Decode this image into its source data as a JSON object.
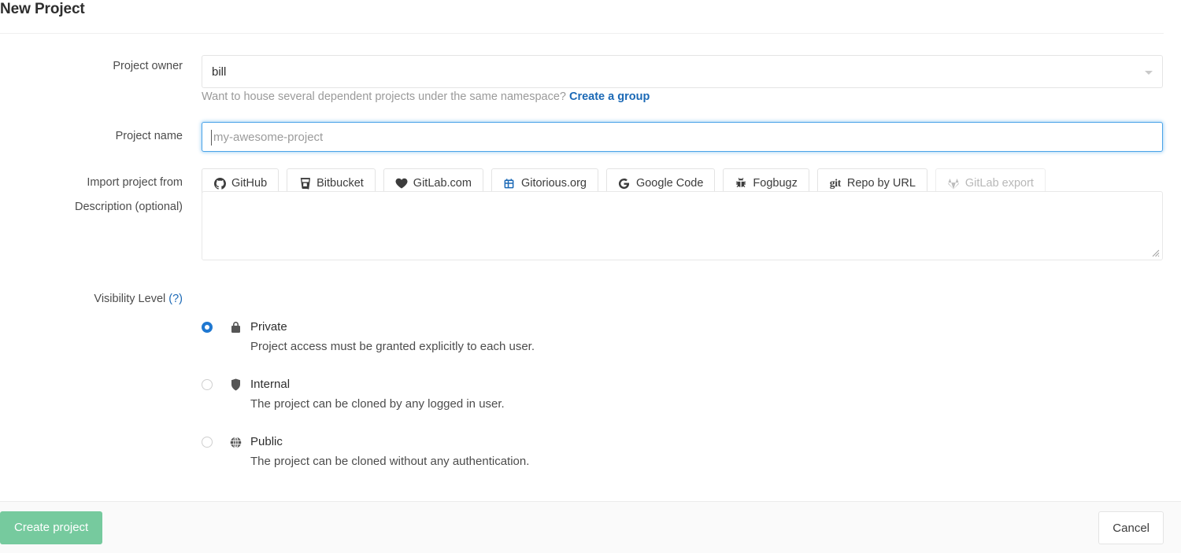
{
  "header": {
    "title": "New Project"
  },
  "form": {
    "owner": {
      "label": "Project owner",
      "value": "bill",
      "caret_icon": "chevron-down-icon",
      "helper_prefix": "Want to house several dependent projects under the same namespace?",
      "helper_link": "Create a group"
    },
    "name": {
      "label": "Project name",
      "value": "",
      "placeholder": "my-awesome-project"
    },
    "import": {
      "label": "Import project from",
      "buttons": [
        {
          "label": "GitHub",
          "icon": "github-icon",
          "disabled": false
        },
        {
          "label": "Bitbucket",
          "icon": "bitbucket-icon",
          "disabled": false
        },
        {
          "label": "GitLab.com",
          "icon": "heart-icon",
          "disabled": false
        },
        {
          "label": "Gitorious.org",
          "icon": "gitorious-icon",
          "disabled": false
        },
        {
          "label": "Google Code",
          "icon": "google-icon",
          "disabled": false
        },
        {
          "label": "Fogbugz",
          "icon": "bug-icon",
          "disabled": false
        },
        {
          "label": "Repo by URL",
          "icon": "git-text-icon",
          "disabled": false
        },
        {
          "label": "GitLab export",
          "icon": "gitlab-fox-icon",
          "disabled": true
        }
      ]
    },
    "description": {
      "label": "Description (optional)",
      "value": "",
      "resize_handle_icon": "resize-grip-icon"
    },
    "visibility": {
      "label": "Visibility Level",
      "help_label": "(?)",
      "options": [
        {
          "title": "Private",
          "icon": "lock-icon",
          "description": "Project access must be granted explicitly to each user.",
          "selected": true
        },
        {
          "title": "Internal",
          "icon": "shield-icon",
          "description": "The project can be cloned by any logged in user.",
          "selected": false
        },
        {
          "title": "Public",
          "icon": "globe-icon",
          "description": "The project can be cloned without any authentication.",
          "selected": false
        }
      ]
    }
  },
  "footer": {
    "create_label": "Create project",
    "cancel_label": "Cancel"
  },
  "colors": {
    "link": "#1b69b6",
    "focus_border": "#4aa3e8",
    "radio_selected": "#1f78d1",
    "create_button": "#76ca9e",
    "footer_bg": "#fafafa"
  }
}
